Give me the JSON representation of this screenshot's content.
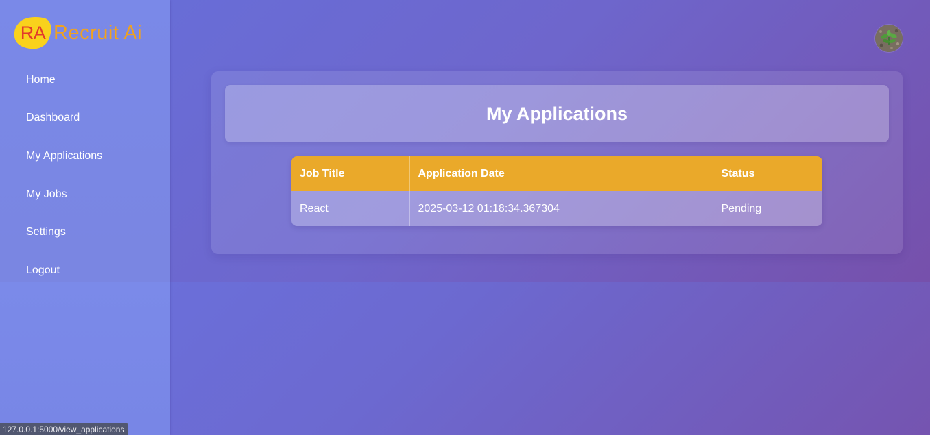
{
  "brand": {
    "mark": "RA",
    "name": "Recruit Ai"
  },
  "sidebar": {
    "items": [
      {
        "label": "Home"
      },
      {
        "label": "Dashboard"
      },
      {
        "label": "My Applications"
      },
      {
        "label": "My Jobs"
      },
      {
        "label": "Settings"
      },
      {
        "label": "Logout"
      }
    ]
  },
  "header": {
    "avatar_icon": "user-avatar-plant-photo"
  },
  "main": {
    "title": "My Applications",
    "table": {
      "columns": [
        "Job Title",
        "Application Date",
        "Status"
      ],
      "rows": [
        [
          "React",
          "2025-03-12 01:18:34.367304",
          "Pending"
        ]
      ]
    }
  },
  "statusbar": {
    "url": "127.0.0.1:5000/view_applications"
  },
  "colors": {
    "accent": "#eaa92a",
    "logo_mark": "#e23b2b",
    "logo_text": "#f0a21f",
    "logo_blob": "#f9d21c"
  }
}
